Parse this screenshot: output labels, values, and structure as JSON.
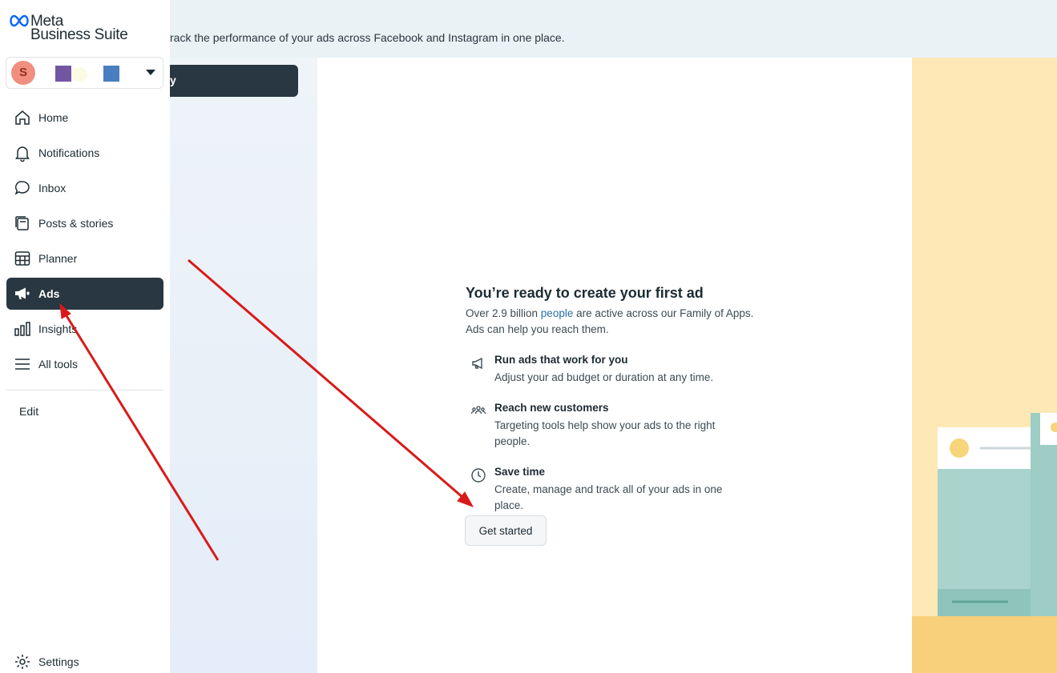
{
  "sidebar": {
    "logo": {
      "line1": "Meta",
      "line2": "Business Suite"
    },
    "account": {
      "avatar_letter": "S"
    },
    "nav": [
      {
        "label": "Home",
        "icon": "home-icon"
      },
      {
        "label": "Notifications",
        "icon": "bell-icon"
      },
      {
        "label": "Inbox",
        "icon": "chat-bubble-icon"
      },
      {
        "label": "Posts & stories",
        "icon": "posts-icon"
      },
      {
        "label": "Planner",
        "icon": "calendar-grid-icon"
      },
      {
        "label": "Ads",
        "icon": "megaphone-icon",
        "active": true
      },
      {
        "label": "Insights",
        "icon": "bar-chart-icon"
      },
      {
        "label": "All tools",
        "icon": "menu-icon"
      }
    ],
    "edit_label": "Edit",
    "settings_label": "Settings"
  },
  "header": {
    "subtitle": "rack the performance of your ads across Facebook and Instagram in one place.",
    "button_label": "y"
  },
  "card": {
    "title": "You’re ready to create your first ad",
    "intro_before": "Over 2.9 billion ",
    "intro_link": "people",
    "intro_after": " are active across our Family of Apps.",
    "intro_line2": "Ads can help you reach them.",
    "features": [
      {
        "icon": "megaphone-icon",
        "title": "Run ads that work for you",
        "desc": "Adjust your ad budget or duration at any time."
      },
      {
        "icon": "people-icon",
        "title": "Reach new customers",
        "desc": "Targeting tools help show your ads to the right people."
      },
      {
        "icon": "clock-icon",
        "title": "Save time",
        "desc": "Create, manage and track all of your ads in one place."
      }
    ],
    "cta_label": "Get started"
  },
  "colors": {
    "sidebar_active": "#283741",
    "link": "#2770a8",
    "annotation_arrow": "#d91a1a",
    "illustration_bg": "#fde8b6"
  }
}
